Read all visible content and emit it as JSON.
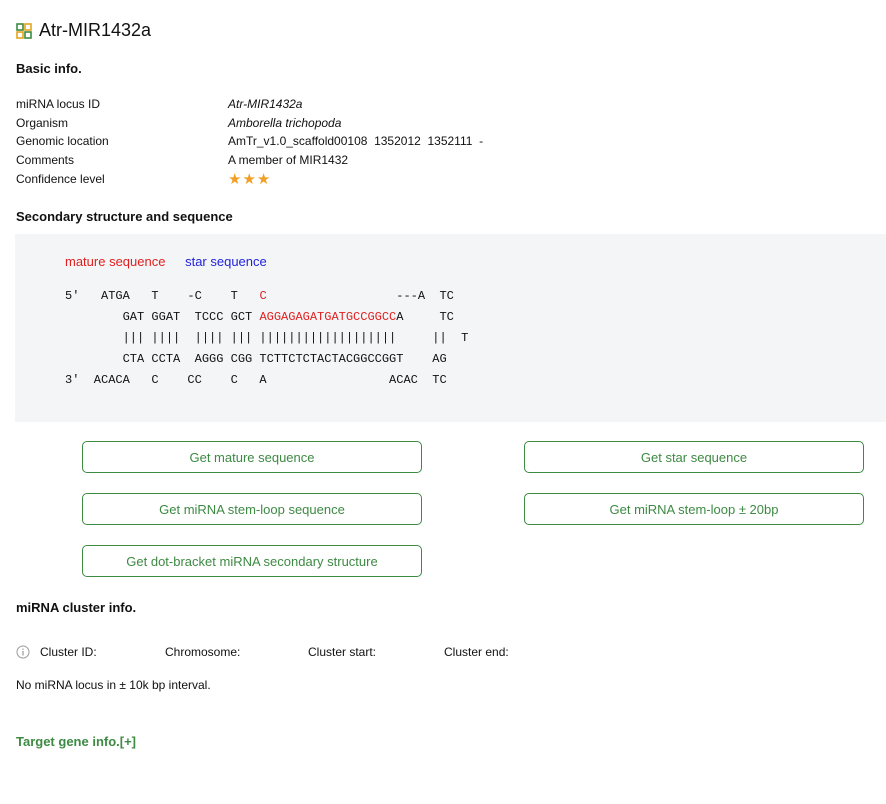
{
  "header": {
    "title": "Atr-MIR1432a",
    "icon": "grid-icon"
  },
  "basic_info": {
    "heading": "Basic info.",
    "rows": [
      {
        "label": "miRNA locus ID",
        "value": "Atr-MIR1432a"
      },
      {
        "label": "Organism",
        "value": "Amborella trichopoda"
      },
      {
        "label": "Genomic location",
        "value": "AmTr_v1.0_scaffold00108  1352012  1352111  -"
      },
      {
        "label": "Comments",
        "value": "A member of MIR1432"
      },
      {
        "label": "Confidence level",
        "value": "★★★",
        "stars": 3
      }
    ]
  },
  "structure": {
    "heading": "Secondary structure and sequence",
    "legend_mature": "mature sequence",
    "legend_star": "star sequence",
    "colors": {
      "mature": "#e02020",
      "star": "#2222dd",
      "accent": "#3d8a43"
    },
    "line1_a": "5'   ATGA   T    -C    T   ",
    "line1_b": "C",
    "line1_c": "                  ---A  TC",
    "line2_a": "        GAT GGAT  TCCC GCT ",
    "line2_b": "AGGAGAGATGATGCCGGCC",
    "line2_c": "A     TC",
    "line3": "        ||| ||||  |||| ||| |||||||||||||||||||     ||  T",
    "line4": "        CTA CCTA  AGGG CGG TCTTCTCTACTACGGCCGGT    AG",
    "line5": "3'  ACACA   C    CC    C   A                 ACAC  TC"
  },
  "buttons": {
    "get_mature": "Get mature sequence",
    "get_star": "Get star sequence",
    "get_stem_loop": "Get miRNA stem-loop sequence",
    "get_stem_loop_20bp": "Get miRNA stem-loop ± 20bp",
    "get_dot_bracket": "Get dot-bracket miRNA secondary structure"
  },
  "cluster": {
    "heading": "miRNA cluster info.",
    "icon": "info-icon",
    "columns": [
      "Cluster ID:",
      "Chromosome:",
      "Cluster start:",
      "Cluster end:"
    ],
    "message": "No miRNA locus in ± 10k bp interval."
  },
  "target": {
    "label": "Target gene info.[+]"
  }
}
